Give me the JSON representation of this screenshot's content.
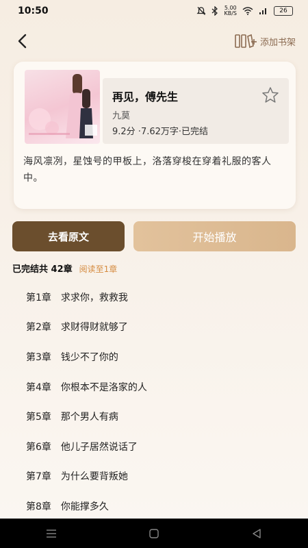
{
  "status": {
    "time": "10:50",
    "speed_value": "5.00",
    "speed_unit": "KB/S",
    "battery": "26"
  },
  "header": {
    "add_shelf_label": "添加书架"
  },
  "book": {
    "title": "再见，傅先生",
    "author": "九莫",
    "meta": "9.2分 ·7.62万字·已完结",
    "description": "海风凛冽，星蚀号的甲板上，洛落穿梭在穿着礼服的客人中。"
  },
  "buttons": {
    "read_original": "去看原文",
    "start_play": "开始播放"
  },
  "chapter_summary": {
    "main": "已完结共 42章",
    "progress": "阅读至1章"
  },
  "chapters": [
    {
      "num": "第1章",
      "title": "求求你，救救我"
    },
    {
      "num": "第2章",
      "title": "求财得财就够了"
    },
    {
      "num": "第3章",
      "title": "钱少不了你的"
    },
    {
      "num": "第4章",
      "title": "你根本不是洛家的人"
    },
    {
      "num": "第5章",
      "title": "那个男人有病"
    },
    {
      "num": "第6章",
      "title": "他儿子居然说话了"
    },
    {
      "num": "第7章",
      "title": "为什么要背叛她"
    },
    {
      "num": "第8章",
      "title": "你能撑多久"
    }
  ],
  "colors": {
    "primary_button": "#6b4e2d",
    "play_button": "#d9b68d",
    "progress_text": "#d58b3f"
  }
}
